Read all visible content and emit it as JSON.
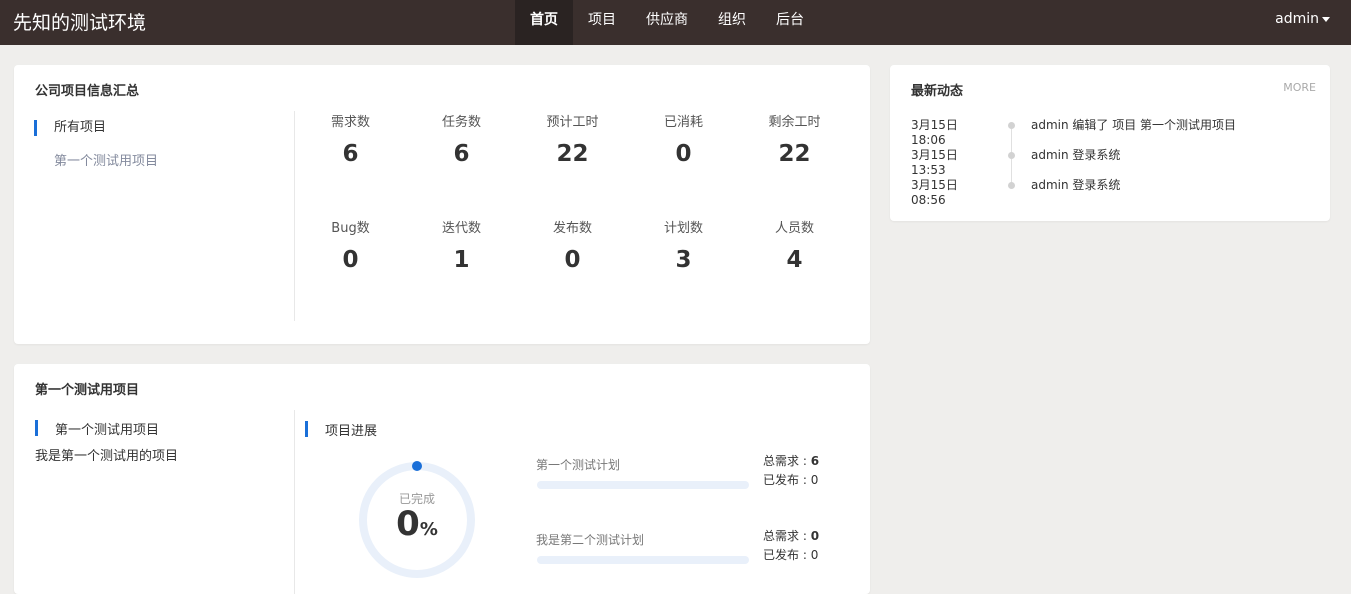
{
  "navbar": {
    "brand": "先知的测试环境",
    "menu": [
      {
        "label": "首页",
        "active": true
      },
      {
        "label": "项目",
        "active": false
      },
      {
        "label": "供应商",
        "active": false
      },
      {
        "label": "组织",
        "active": false
      },
      {
        "label": "后台",
        "active": false
      }
    ],
    "user": "admin"
  },
  "summary": {
    "title": "公司项目信息汇总",
    "project_nav": [
      {
        "label": "所有项目",
        "active": true
      },
      {
        "label": "第一个测试用项目",
        "active": false
      }
    ],
    "stats": [
      {
        "label": "需求数",
        "value": "6"
      },
      {
        "label": "任务数",
        "value": "6"
      },
      {
        "label": "预计工时",
        "value": "22"
      },
      {
        "label": "已消耗",
        "value": "0"
      },
      {
        "label": "剩余工时",
        "value": "22"
      },
      {
        "label": "Bug数",
        "value": "0"
      },
      {
        "label": "迭代数",
        "value": "1"
      },
      {
        "label": "发布数",
        "value": "0"
      },
      {
        "label": "计划数",
        "value": "3"
      },
      {
        "label": "人员数",
        "value": "4"
      }
    ]
  },
  "activity": {
    "title": "最新动态",
    "more": "MORE",
    "items": [
      {
        "time": "3月15日 18:06",
        "text": "admin 编辑了 项目 第一个测试用项目"
      },
      {
        "time": "3月15日 13:53",
        "text": "admin 登录系统"
      },
      {
        "time": "3月15日 08:56",
        "text": "admin 登录系统"
      }
    ]
  },
  "project": {
    "title": "第一个测试用项目",
    "name": "第一个测试用项目",
    "description": "我是第一个测试用的项目",
    "progress_title": "项目进展",
    "completed_label": "已完成",
    "completed_value": "0",
    "completed_unit": "%",
    "completed_fraction": 0,
    "plans": [
      {
        "name": "第一个测试计划",
        "total_label": "总需求 : ",
        "total": "6",
        "released_label": "已发布 : ",
        "released": "0",
        "progress": 0
      },
      {
        "name": "我是第二个测试计划",
        "total_label": "总需求 : ",
        "total": "0",
        "released_label": "已发布 : ",
        "released": "0",
        "progress": 0
      }
    ]
  },
  "colors": {
    "navbar": "#3a2f2d",
    "accent": "#1a6fd8",
    "ring_track": "#e9f0fa"
  }
}
